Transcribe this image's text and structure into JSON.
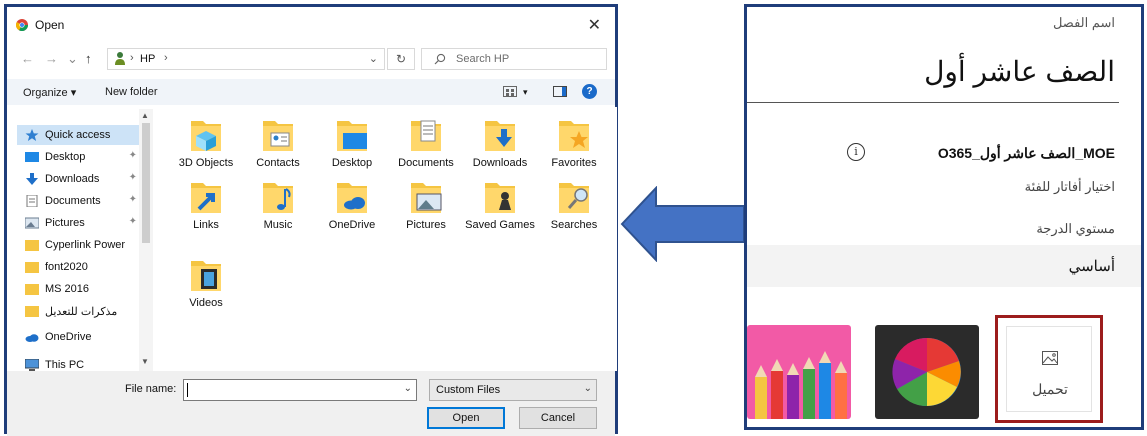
{
  "dialog": {
    "title": "Open",
    "close_glyph": "✕",
    "nav": {
      "back": "←",
      "forward": "→",
      "up": "↑"
    },
    "breadcrumb": {
      "separator": "›",
      "location": "HP",
      "dropdown": "⌄"
    },
    "refresh_glyph": "↻",
    "search_placeholder": "Search HP",
    "toolbar": {
      "organize": "Organize ▾",
      "new_folder": "New folder",
      "view_dropdown": "▾",
      "help": "?"
    },
    "sidebar": {
      "items": [
        {
          "label": "Quick access",
          "icon": "star-icon",
          "pinned": false,
          "selected": true
        },
        {
          "label": "Desktop",
          "icon": "desktop-icon",
          "pinned": true
        },
        {
          "label": "Downloads",
          "icon": "download-icon",
          "pinned": true
        },
        {
          "label": "Documents",
          "icon": "document-icon",
          "pinned": true
        },
        {
          "label": "Pictures",
          "icon": "pictures-icon",
          "pinned": true
        },
        {
          "label": "Cyperlink Power",
          "icon": "folder-icon",
          "pinned": false
        },
        {
          "label": "font2020",
          "icon": "folder-icon",
          "pinned": false
        },
        {
          "label": "MS 2016",
          "icon": "folder-icon",
          "pinned": false
        },
        {
          "label": "مذكرات للتعديل",
          "icon": "folder-icon",
          "pinned": false
        },
        {
          "label": "OneDrive",
          "icon": "cloud-icon",
          "pinned": false
        },
        {
          "label": "This PC",
          "icon": "computer-icon",
          "pinned": false
        }
      ],
      "pin_glyph": "📌"
    },
    "files": [
      {
        "label": "3D Objects",
        "icon": "3d-objects-folder-icon"
      },
      {
        "label": "Contacts",
        "icon": "contacts-folder-icon"
      },
      {
        "label": "Desktop",
        "icon": "desktop-folder-icon"
      },
      {
        "label": "Documents",
        "icon": "documents-folder-icon"
      },
      {
        "label": "Downloads",
        "icon": "downloads-folder-icon"
      },
      {
        "label": "Favorites",
        "icon": "favorites-folder-icon"
      },
      {
        "label": "Links",
        "icon": "links-folder-icon"
      },
      {
        "label": "Music",
        "icon": "music-folder-icon"
      },
      {
        "label": "OneDrive",
        "icon": "onedrive-folder-icon"
      },
      {
        "label": "Pictures",
        "icon": "pictures-folder-icon"
      },
      {
        "label": "Saved Games",
        "icon": "saved-games-folder-icon"
      },
      {
        "label": "Searches",
        "icon": "searches-folder-icon"
      },
      {
        "label": "Videos",
        "icon": "videos-folder-icon"
      }
    ],
    "file_name_label": "File name:",
    "file_name_value": "",
    "file_type": "Custom Files",
    "buttons": {
      "open": "Open",
      "cancel": "Cancel"
    },
    "colors": {
      "frame": "#1f3d7a",
      "selection": "#cde3f7",
      "accent": "#0078d7"
    }
  },
  "arrow": {
    "color": "#4472c4",
    "direction": "left"
  },
  "class_panel": {
    "class_name_label": "اسم الفصل",
    "class_name_value": "الصف عاشر أول",
    "team_name": "MOE_الصف عاشر أول_O365",
    "info_glyph": "i",
    "choose_avatar": "اختيار أفاتار للفئة",
    "grade_level_label": "مستوي الدرجة",
    "grade_level_value": "أساسي",
    "upload_label": "تحميل",
    "colors": {
      "frame": "#1f3d7a",
      "upload_highlight": "#9c1c1c"
    }
  }
}
